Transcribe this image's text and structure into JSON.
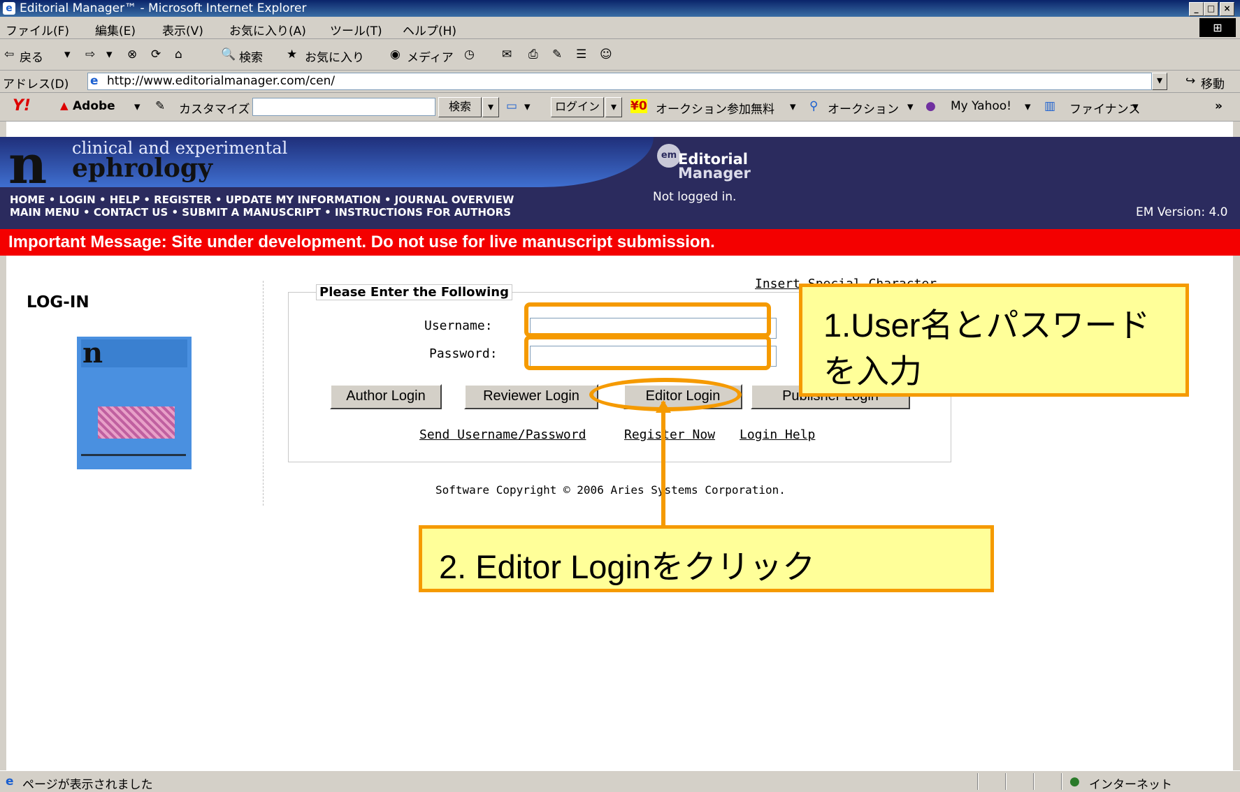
{
  "window": {
    "title": "Editorial Manager™ - Microsoft Internet Explorer"
  },
  "menu": [
    "ファイル(F)",
    "編集(E)",
    "表示(V)",
    "お気に入り(A)",
    "ツール(T)",
    "ヘルプ(H)"
  ],
  "toolbar": {
    "back": "戻る",
    "search": "検索",
    "favorites": "お気に入り",
    "media": "メディア"
  },
  "address": {
    "label": "アドレス(D)",
    "url": "http://www.editorialmanager.com/cen/",
    "go": "移動"
  },
  "yahoo_toolbar": {
    "logo": "Y!",
    "adobe": "Adobe",
    "customize": "カスタマイズ",
    "search": "検索",
    "login": "ログイン",
    "auction_free": "オークション参加無料",
    "auction": "オークション",
    "my_yahoo": "My Yahoo!",
    "finance": "ファイナンス",
    "more": "»"
  },
  "site": {
    "logo_letter": "n",
    "logo_line1": "clinical and experimental",
    "logo_line2": "ephrology",
    "em_badge": "em",
    "em_line1": "Editorial",
    "em_line2": "Manager",
    "nav_line1": "HOME • LOGIN • HELP • REGISTER • UPDATE MY INFORMATION • JOURNAL OVERVIEW",
    "nav_line2": "MAIN MENU • CONTACT US • SUBMIT A MANUSCRIPT • INSTRUCTIONS FOR AUTHORS",
    "status": "Not logged in.",
    "version": "EM Version: 4.0",
    "message": "Important Message: Site under development. Do not use for live manuscript submission."
  },
  "login": {
    "heading": "LOG-IN",
    "legend": "Please Enter the Following",
    "special_char": "Insert Special Character",
    "username_label": "Username:",
    "password_label": "Password:",
    "buttons": [
      "Author Login",
      "Reviewer Login",
      "Editor Login",
      "Publisher Login"
    ],
    "links": [
      "Send Username/Password",
      "Register Now",
      "Login Help"
    ],
    "copyright": "Software Copyright © 2006 Aries Systems Corporation."
  },
  "annotations": {
    "step1_line1": "1.User名とパスワード",
    "step1_line2": "を入力",
    "step2": "2. Editor Loginをクリック",
    "color": "#f59a00"
  },
  "statusbar": {
    "text": "ページが表示されました",
    "zone": "インターネット"
  }
}
